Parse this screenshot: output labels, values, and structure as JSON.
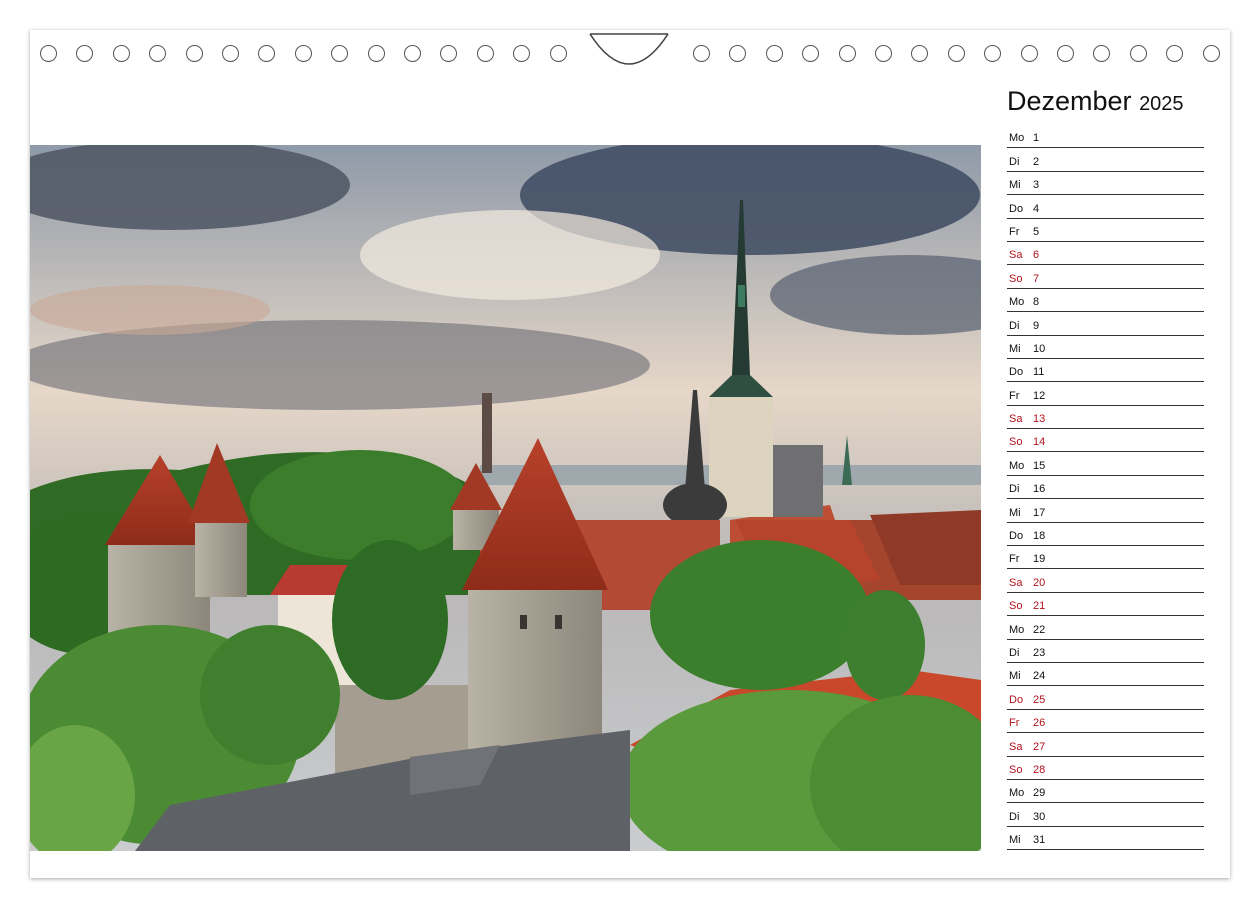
{
  "calendar": {
    "month": "Dezember",
    "year": "2025"
  },
  "photo": {
    "subject": "Tallinn old town skyline"
  },
  "colors": {
    "weekday_text": "#111111",
    "holiday_text": "#b0121b",
    "rule_line": "#333333"
  },
  "days": [
    {
      "wd": "Mo",
      "d": "1",
      "red": false
    },
    {
      "wd": "Di",
      "d": "2",
      "red": false
    },
    {
      "wd": "Mi",
      "d": "3",
      "red": false
    },
    {
      "wd": "Do",
      "d": "4",
      "red": false
    },
    {
      "wd": "Fr",
      "d": "5",
      "red": false
    },
    {
      "wd": "Sa",
      "d": "6",
      "red": true
    },
    {
      "wd": "So",
      "d": "7",
      "red": true
    },
    {
      "wd": "Mo",
      "d": "8",
      "red": false
    },
    {
      "wd": "Di",
      "d": "9",
      "red": false
    },
    {
      "wd": "Mi",
      "d": "10",
      "red": false
    },
    {
      "wd": "Do",
      "d": "11",
      "red": false
    },
    {
      "wd": "Fr",
      "d": "12",
      "red": false
    },
    {
      "wd": "Sa",
      "d": "13",
      "red": true
    },
    {
      "wd": "So",
      "d": "14",
      "red": true
    },
    {
      "wd": "Mo",
      "d": "15",
      "red": false
    },
    {
      "wd": "Di",
      "d": "16",
      "red": false
    },
    {
      "wd": "Mi",
      "d": "17",
      "red": false
    },
    {
      "wd": "Do",
      "d": "18",
      "red": false
    },
    {
      "wd": "Fr",
      "d": "19",
      "red": false
    },
    {
      "wd": "Sa",
      "d": "20",
      "red": true
    },
    {
      "wd": "So",
      "d": "21",
      "red": true
    },
    {
      "wd": "Mo",
      "d": "22",
      "red": false
    },
    {
      "wd": "Di",
      "d": "23",
      "red": false
    },
    {
      "wd": "Mi",
      "d": "24",
      "red": false
    },
    {
      "wd": "Do",
      "d": "25",
      "red": true
    },
    {
      "wd": "Fr",
      "d": "26",
      "red": true
    },
    {
      "wd": "Sa",
      "d": "27",
      "red": true
    },
    {
      "wd": "So",
      "d": "28",
      "red": true
    },
    {
      "wd": "Mo",
      "d": "29",
      "red": false
    },
    {
      "wd": "Di",
      "d": "30",
      "red": false
    },
    {
      "wd": "Mi",
      "d": "31",
      "red": false
    }
  ]
}
